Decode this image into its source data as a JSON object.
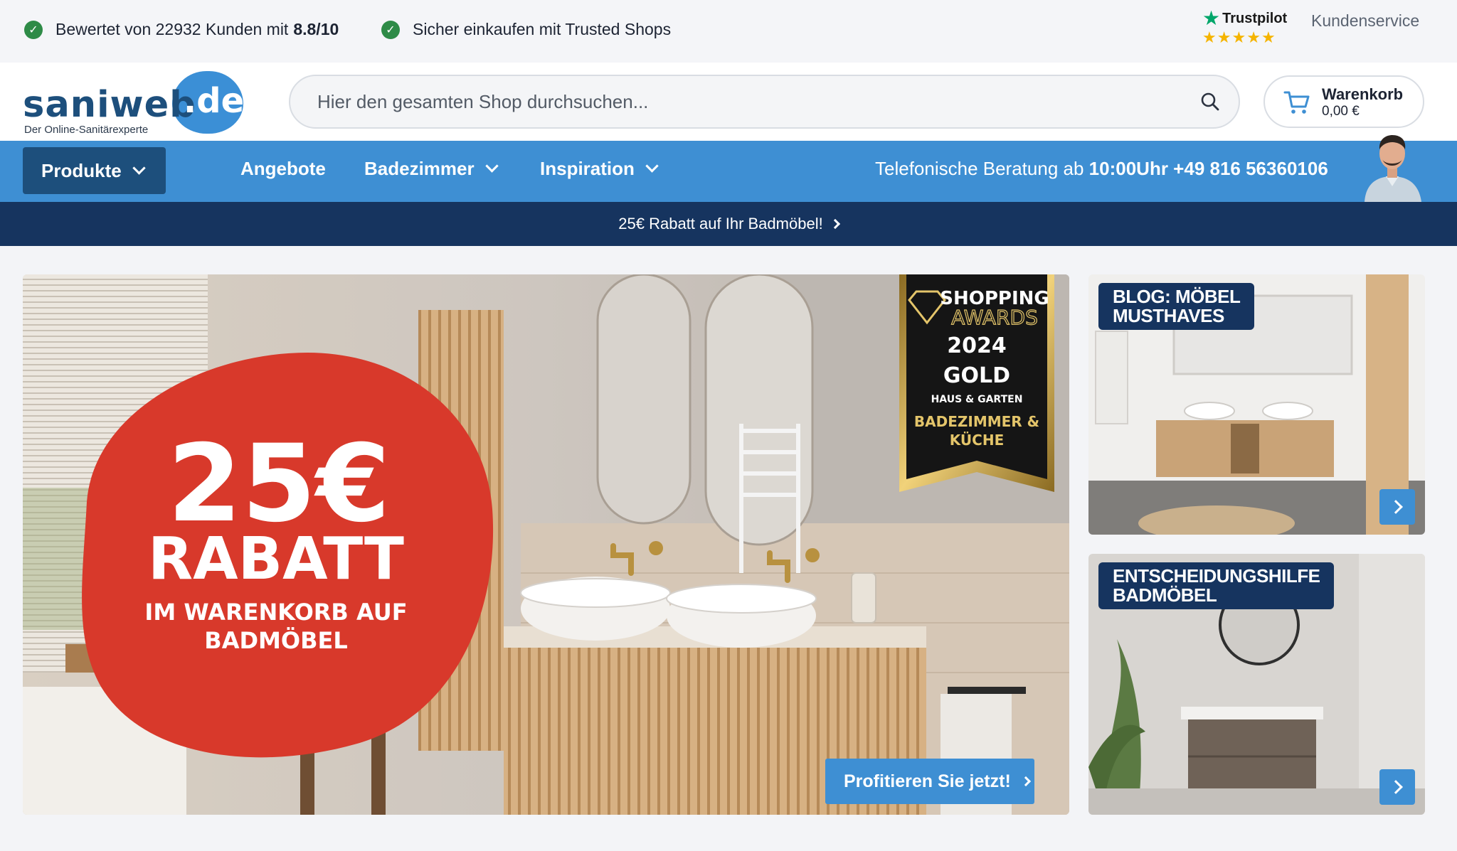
{
  "topbar": {
    "rating_prefix": "Bewertet von 22932 Kunden mit",
    "rating_value": "8.8/10",
    "trusted_shops": "Sicher einkaufen mit Trusted Shops",
    "trustpilot_name": "Trustpilot",
    "trustpilot_stars": 5,
    "customer_service": "Kundenservice"
  },
  "header": {
    "logo_main": "saniweb",
    "logo_tld": ".de",
    "logo_tagline": "Der Online-Sanitärexperte",
    "search_placeholder": "Hier den gesamten Shop durchsuchen...",
    "cart_label": "Warenkorb",
    "cart_value": "0,00 €"
  },
  "nav": {
    "products": "Produkte",
    "offers": "Angebote",
    "bathroom": "Badezimmer",
    "inspiration": "Inspiration",
    "phone_prefix": "Telefonische Beratung ab",
    "phone_bold": "10:00Uhr +49 816 56360106"
  },
  "promo": {
    "text": "25€ Rabatt auf Ihr Badmöbel!"
  },
  "hero": {
    "discount_amount": "25€",
    "discount_word": "RABATT",
    "discount_line1": "IM WARENKORB AUF",
    "discount_line2": "BADMÖBEL",
    "award_line1": "SHOPPING",
    "award_line2": "AWARDS",
    "award_year": "2024",
    "award_level": "GOLD",
    "award_category": "HAUS & GARTEN",
    "award_sub1": "BADEZIMMER &",
    "award_sub2": "KÜCHE",
    "cta": "Profitieren Sie jetzt!"
  },
  "cards": [
    {
      "line1": "BLOG: MÖBEL",
      "line2": "MUSTHAVES"
    },
    {
      "line1": "ENTSCHEIDUNGSHILFE",
      "line2": "BADMÖBEL"
    }
  ],
  "colors": {
    "brand_blue": "#3e8fd3",
    "navy": "#16345f",
    "logo_navy": "#1d4f7c",
    "promo_red": "#d8392b",
    "check_green": "#2e8b47",
    "star_gold": "#f5b400"
  }
}
